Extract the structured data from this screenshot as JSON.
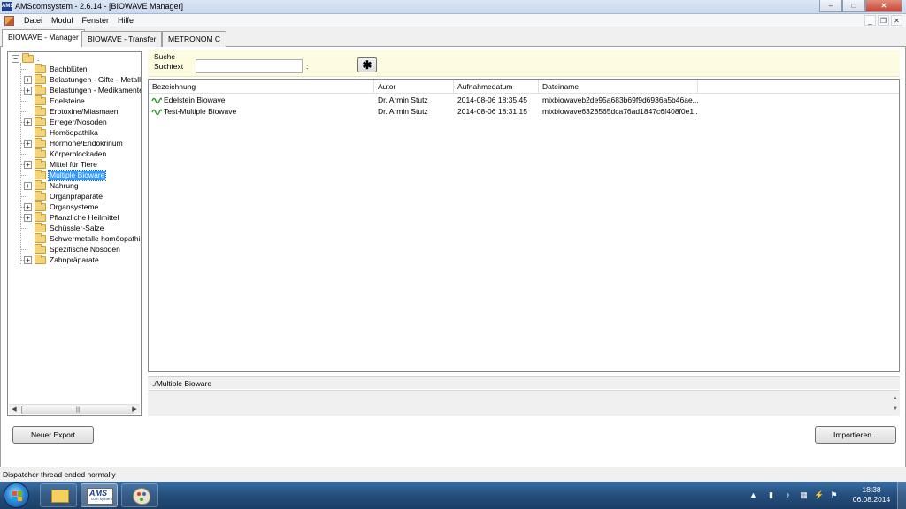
{
  "window": {
    "title": "AMScomsystem - 2.6.14 - [BIOWAVE Manager]",
    "app_icon_text": "AMS",
    "controls": {
      "minimize": "–",
      "maximize": "□",
      "close": "✕"
    }
  },
  "menubar": {
    "items": [
      "Datei",
      "Modul",
      "Fenster",
      "Hilfe"
    ],
    "mdi_controls": {
      "minimize": "_",
      "restore": "❐",
      "close": "✕"
    }
  },
  "tabs": [
    {
      "label": "BIOWAVE - Manager",
      "active": true
    },
    {
      "label": "BIOWAVE - Transfer",
      "active": false
    },
    {
      "label": "METRONOM C",
      "active": false
    }
  ],
  "tree": {
    "root_label": ".",
    "items": [
      {
        "label": "Bachblüten",
        "expandable": false
      },
      {
        "label": "Belastungen - Gifte - Metalle",
        "expandable": true
      },
      {
        "label": "Belastungen - Medikamente",
        "expandable": true
      },
      {
        "label": "Edelsteine",
        "expandable": false
      },
      {
        "label": "Erbtoxine/Miasmaen",
        "expandable": false
      },
      {
        "label": "Erreger/Nosoden",
        "expandable": true
      },
      {
        "label": "Homöopathika",
        "expandable": false
      },
      {
        "label": "Hormone/Endokrinum",
        "expandable": true
      },
      {
        "label": "Körperblockaden",
        "expandable": false
      },
      {
        "label": "Mittel für Tiere",
        "expandable": true
      },
      {
        "label": "Multiple Bioware",
        "expandable": false,
        "selected": true
      },
      {
        "label": "Nahrung",
        "expandable": true
      },
      {
        "label": "Organpräparate",
        "expandable": false
      },
      {
        "label": "Organsysteme",
        "expandable": true
      },
      {
        "label": "Pflanzliche Heilmittel",
        "expandable": true
      },
      {
        "label": "Schüssler-Salze",
        "expandable": false
      },
      {
        "label": "Schwermetalle homöopathisc",
        "expandable": false
      },
      {
        "label": "Spezifische Nosoden",
        "expandable": false
      },
      {
        "label": "Zahnpräparate",
        "expandable": true
      }
    ]
  },
  "search": {
    "section_label": "Suche",
    "field_label": "Suchtext",
    "value": "",
    "colon": ":",
    "wildcard_button": "✱"
  },
  "grid": {
    "columns": [
      "Bezeichnung",
      "Autor",
      "Aufnahmedatum",
      "Dateiname"
    ],
    "rows": [
      [
        "Edelstein Biowave",
        "Dr. Armin Stutz",
        "2014-08-06 18:35:45",
        "mixbiowaveb2de95a683b69f9d6936a5b46ae..."
      ],
      [
        "Test-Multiple Biowave",
        "Dr. Armin Stutz",
        "2014-08-06 18:31:15",
        "mixbiowave6328565dca76ad1847c6f408f0e1..."
      ]
    ]
  },
  "path": "./Multiple Bioware",
  "buttons": {
    "new_export": "Neuer Export",
    "import": "Importieren..."
  },
  "status": "Dispatcher thread ended normally",
  "taskbar": {
    "ams_label": "AMS",
    "ams_sub": "com system",
    "clock_time": "18:38",
    "clock_date": "06.08.2014"
  }
}
